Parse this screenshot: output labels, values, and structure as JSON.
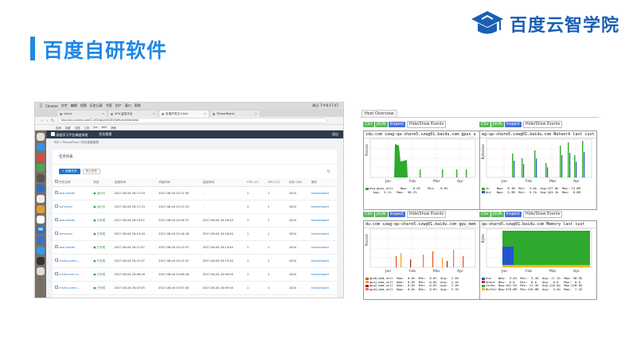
{
  "slide": {
    "title": "百度自研软件",
    "brand": "百度云智学院",
    "colors": {
      "accent": "#1e88e5",
      "brand": "#1a5fb4"
    }
  },
  "browser": {
    "menu": [
      "Chrome",
      "文件",
      "编辑",
      "视图",
      "历史记录",
      "书签",
      "用户",
      "窗口",
      "帮助"
    ],
    "clock": "周日 下午6:17:47",
    "tabs": [
      "cloud",
      "404 监控平台",
      "百度开发文-hibtu",
      "TensorBoard"
    ],
    "url": "bjyz-bcc-online-com3-163.bjyz:8130/hdfs/e/#/list/task",
    "bookmarks": [
      "应用",
      "百度",
      "文档",
      "工具",
      "jira",
      "wiki",
      "其他"
    ]
  },
  "app": {
    "header": "深度学习平台调度系统",
    "nav": "任务管理",
    "user": "退出",
    "breadcrumb": "BDL / TensorFlow / 任务调度管理",
    "card_title": "任务列表",
    "new_job": "+ 新建任务",
    "batch_stop": "停止任务",
    "columns": [
      "任务名称",
      "状态",
      "创建时间",
      "开始时间",
      "结束时间",
      "CPU (个)",
      "GPU (个)",
      "内存 (GB)",
      "操作"
    ],
    "jobs": [
      {
        "name": "seal-model",
        "status": "运行中",
        "created": "2017-06-04 20:17:29",
        "started": "2017-06-04 20:17:30",
        "ended": "-",
        "cpu": "1",
        "gpu": "1",
        "mem": "1024",
        "op": "tensorboard"
      },
      {
        "name": "summary",
        "status": "运行中",
        "created": "2017-06-04 20:17:13",
        "started": "2017-06-04 20:17:13",
        "ended": "-",
        "cpu": "1",
        "gpu": "1",
        "mem": "1024",
        "op": "tensorboard"
      },
      {
        "name": "seal-model",
        "status": "已完成",
        "created": "2017-06-04 20:14:57",
        "started": "2017-06-04 20:14:57",
        "ended": "2017-06-04 20:16:24",
        "cpu": "1",
        "gpu": "1",
        "mem": "1024",
        "op": "tensorboard"
      },
      {
        "name": "summary",
        "status": "已完成",
        "created": "2017-06-04 20:14:18",
        "started": "2017-06-04 20:14:18",
        "ended": "2017-06-04 20:16:04",
        "cpu": "1",
        "gpu": "1",
        "mem": "1024",
        "op": "tensorboard"
      },
      {
        "name": "seal-model",
        "status": "已完成",
        "created": "2017-06-04 20:11:57",
        "started": "2017-06-04 20:11:57",
        "ended": "2017-06-04 20:13:44",
        "cpu": "1",
        "gpu": "1",
        "mem": "1024",
        "op": "tensorboard"
      },
      {
        "name": "mnist-summ...",
        "status": "已完成",
        "created": "2017-06-04 20:11:37",
        "started": "2017-06-04 20:11:37",
        "ended": "2017-06-04 20:13:24",
        "cpu": "1",
        "gpu": "1",
        "mem": "1024",
        "op": "tensorboard"
      },
      {
        "name": "mnist-sum-m...",
        "status": "已完成",
        "created": "2017-06-04 20:08:16",
        "started": "2017-06-04 20:08:16",
        "ended": "2017-06-04 20:09:54",
        "cpu": "1",
        "gpu": "1",
        "mem": "1024",
        "op": "tensorboard"
      },
      {
        "name": "mnist-summ...",
        "status": "已完成",
        "created": "2017-06-04 20:07:45",
        "started": "2017-06-04 20:07:45",
        "ended": "2017-06-04 20:09:34",
        "cpu": "1",
        "gpu": "1",
        "mem": "1024",
        "op": "tensorboard"
      }
    ]
  },
  "host": {
    "tab": "Host Overview",
    "buttons": {
      "csv": "CSV",
      "json": "JSON",
      "inspect": "Inspect",
      "hide": "Hide/Show Events"
    },
    "graphs": [
      {
        "title": "idu.com szwg-qa-share5.szwg01.baidu.com gpus_u",
        "ylabel": "Percent",
        "months": [
          "Jan",
          "Feb",
          "Mar",
          "Apr"
        ],
        "legend": [
          "avg_gpus_util    Now:   0.0%    Min:   0.0%",
          "  Avg:  9.1%   Max:  96.2%"
        ],
        "colors": [
          "#2eaa2e"
        ]
      },
      {
        "title": "wg-qa-share5.szwg01.baidu.com Network last cust",
        "ylabel": "Bytes/sec",
        "months": [
          "Jan",
          "Feb",
          "Mar",
          "Apr"
        ],
        "legend": [
          "In    Now:  8.1M  Min:  3.0k  Avg:237.0k  Max: 13.0M",
          "Out   Now:  5.3M  Min:  5.7k  Avg:163.1k  Max:  8.8M"
        ],
        "colors": [
          "#2eaa2e",
          "#2255cc"
        ]
      },
      {
        "title": "du.com szwg-qa-share5.szwg01.baidu.com gpu_mem",
        "ylabel": "Percent",
        "months": [
          "Jan",
          "Feb",
          "Mar",
          "Apr"
        ],
        "legend": [
          "gpu0_mem_util  Now:  0.0%  Min:  0.0%  Avg:  2.8%",
          "gpu1_mem_util  Now:  0.0%  Min:  0.0%  Avg:  2.4%",
          "gpu2_mem_util  Now:  0.0%  Min:  0.0%  Avg:  2.0%",
          "gpu3_mem_util  Now:  0.0%  Min:  0.0%  Avg:  2.3%"
        ],
        "colors": [
          "#e8501e",
          "#f0a020",
          "#a02020",
          "#f07050"
        ]
      },
      {
        "title": "qa-share5.szwg01.baidu.com Memory last cust",
        "ylabel": "Bytes",
        "months": [
          "Jan",
          "Feb",
          "Mar",
          "Apr"
        ],
        "legend": [
          "Use    Now:  3.4G  Min:  3.4G  Avg: 17.1G  Max: 98.9G",
          "Share  Now:  0.0   Min:  0.0   Avg:  0.0   Max:  0.0",
          "Cache  Now:101.9G  Min: 11.3G  Avg:116.0G  Max:120.0G",
          "Buffer Now:376.0M  Min:244.0M  Avg:  3.4G  Max:  7.2G"
        ],
        "colors": [
          "#2255cc",
          "#cc2222",
          "#2eaa2e",
          "#e0c020"
        ]
      }
    ]
  }
}
